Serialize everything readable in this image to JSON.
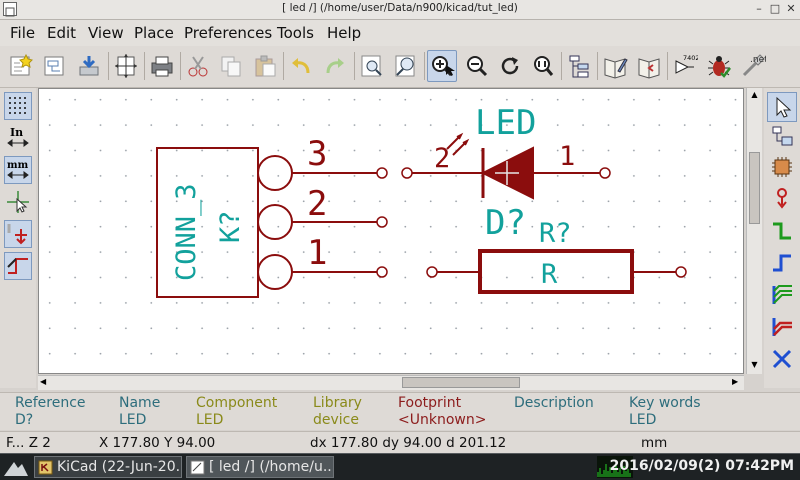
{
  "window": {
    "title": "[ led /] (/home/user/Data/n900/kicad/tut_led)",
    "minimize_glyph": "–",
    "maximize_glyph": "□",
    "close_glyph": "✕"
  },
  "menu": [
    {
      "label": "File"
    },
    {
      "label": "Edit"
    },
    {
      "label": "View"
    },
    {
      "label": "Place"
    },
    {
      "label": "Preferences"
    },
    {
      "label": "Tools"
    },
    {
      "label": "Help"
    }
  ],
  "toolbar": {
    "netlist_num_label": "7402",
    "net_label": ".net",
    "active_tool": "zoom-in"
  },
  "left_toolbar": {
    "inch_label": "In",
    "mm_label": "mm"
  },
  "schematic": {
    "connector": {
      "name": "CONN_3",
      "reference": "K?",
      "pins": [
        "3",
        "2",
        "1"
      ]
    },
    "led": {
      "value": "LED",
      "reference": "D?",
      "pin_left": "2",
      "pin_right": "1"
    },
    "resistor": {
      "reference": "R?",
      "value": "R"
    }
  },
  "message_panel": [
    {
      "header": "Reference",
      "value": "D?",
      "color": "#2d6d7c"
    },
    {
      "header": "Name",
      "value": "LED",
      "color": "#2d6d7c"
    },
    {
      "header": "Component",
      "value": "LED",
      "color": "#8a8a1a"
    },
    {
      "header": "Library",
      "value": "device",
      "color": "#8a8a1a"
    },
    {
      "header": "Footprint",
      "value": "<Unknown>",
      "color": "#8c1c1c"
    },
    {
      "header": "Description",
      "value": "",
      "color": "#2d6d7c"
    },
    {
      "header": "Key words",
      "value": "LED",
      "color": "#2d6d7c"
    }
  ],
  "status": {
    "zoom": "F... Z 2",
    "position": "X 177.80  Y 94.00",
    "delta": "dx 177.80  dy 94.00  d 201.12",
    "units": "mm"
  },
  "taskbar": {
    "tasks": [
      {
        "label": "KiCad (22-Jun-20..."
      },
      {
        "label": "[ led /] (/home/u..."
      }
    ],
    "clock": "2016/02/09(2) 07:42PM"
  },
  "colors": {
    "schematic_wire": "#8b0d0d",
    "schematic_text": "#12a19c",
    "grid_dot": "#9aa1a8"
  }
}
